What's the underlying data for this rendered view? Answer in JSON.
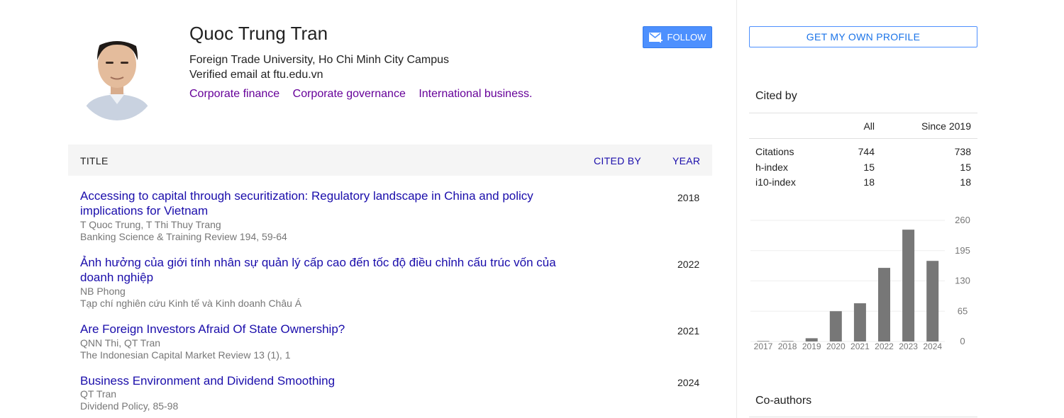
{
  "profile": {
    "name": "Quoc Trung Tran",
    "affiliation": "Foreign Trade University, Ho Chi Minh City Campus",
    "email": "Verified email at ftu.edu.vn",
    "interests": [
      "Corporate finance",
      "Corporate governance",
      "International business."
    ],
    "follow_label": "FOLLOW"
  },
  "table": {
    "headers": {
      "title": "TITLE",
      "cited_by": "CITED BY",
      "year": "YEAR"
    },
    "rows": [
      {
        "title": "Accessing to capital through securitization: Regulatory landscape in China and policy implications for Vietnam",
        "authors": "T Quoc Trung, T Thi Thuy Trang",
        "venue": "Banking Science & Training Review 194, 59-64",
        "cited_by": "",
        "year": "2018"
      },
      {
        "title": "Ảnh hưởng của giới tính nhân sự quản lý cấp cao đến tốc độ điều chỉnh cấu trúc vốn của doanh nghiệp",
        "authors": "NB Phong",
        "venue": "Tạp chí nghiên cứu Kinh tế và Kinh doanh Châu Á",
        "cited_by": "",
        "year": "2022"
      },
      {
        "title": "Are Foreign Investors Afraid Of State Ownership?",
        "authors": "QNN Thi, QT Tran",
        "venue": "The Indonesian Capital Market Review 13 (1), 1",
        "cited_by": "",
        "year": "2021"
      },
      {
        "title": "Business Environment and Dividend Smoothing",
        "authors": "QT Tran",
        "venue": "Dividend Policy, 85-98",
        "cited_by": "",
        "year": "2024"
      }
    ]
  },
  "sidebar": {
    "own_profile_label": "GET MY OWN PROFILE",
    "cited_by_heading": "Cited by",
    "cols": {
      "all": "All",
      "since": "Since 2019"
    },
    "stats": [
      {
        "label": "Citations",
        "all": "744",
        "since": "738"
      },
      {
        "label": "h-index",
        "all": "15",
        "since": "15"
      },
      {
        "label": "i10-index",
        "all": "18",
        "since": "18"
      }
    ],
    "coauthors_heading": "Co-authors"
  },
  "colors": {
    "link": "#1a0dab",
    "interest": "#660099",
    "follow_bg": "#4d90fe",
    "bar": "#777777"
  },
  "chart_data": {
    "type": "bar",
    "categories": [
      "2017",
      "2018",
      "2019",
      "2020",
      "2021",
      "2022",
      "2023",
      "2024"
    ],
    "values": [
      1,
      1,
      7,
      65,
      82,
      158,
      240,
      173
    ],
    "ylim": [
      0,
      260
    ],
    "yticks": [
      "0",
      "65",
      "130",
      "195",
      "260"
    ],
    "grid": true,
    "axis_side": "right"
  }
}
